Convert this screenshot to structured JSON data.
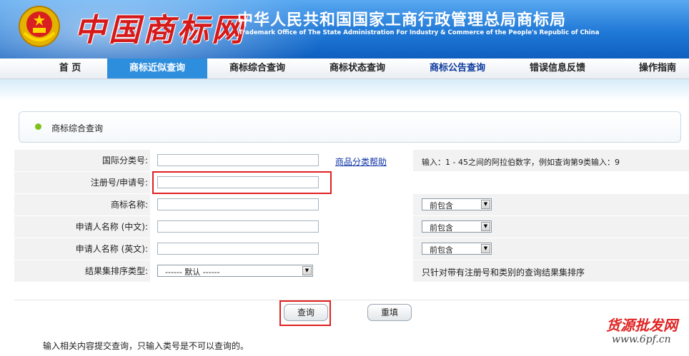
{
  "header": {
    "logo_text": "中国商标网",
    "title_cn": "中华人民共和国国家工商行政管理总局商标局",
    "title_en": "Trademark Office of The State Administration For Industry & Commerce of the People's Republic of China"
  },
  "nav": [
    {
      "label": "首 页",
      "state": "normal"
    },
    {
      "label": "商标近似查询",
      "state": "active"
    },
    {
      "label": "商标综合查询",
      "state": "normal"
    },
    {
      "label": "商标状态查询",
      "state": "normal"
    },
    {
      "label": "商标公告查询",
      "state": "blue"
    },
    {
      "label": "错误信息反馈",
      "state": "normal"
    },
    {
      "label": "操作指南",
      "state": "normal"
    }
  ],
  "section_title": "商标综合查询",
  "form": {
    "class_no": {
      "label": "国际分类号:",
      "value": "",
      "help_link": "商品分类帮助",
      "hint": "输入：1 - 45之间的阿拉伯数字，例如查询第9类输入：9"
    },
    "reg_no": {
      "label": "注册号/申请号:",
      "value": ""
    },
    "tm_name": {
      "label": "商标名称:",
      "value": "",
      "match": "前包含"
    },
    "applicant_cn": {
      "label": "申请人名称 (中文):",
      "value": "",
      "match": "前包含"
    },
    "applicant_en": {
      "label": "申请人名称 (英文):",
      "value": "",
      "match": "前包含"
    },
    "sort": {
      "label": "结果集排序类型:",
      "selected": "------ 默认 ------",
      "hint": "只针对带有注册号和类别的查询结果集排序"
    }
  },
  "buttons": {
    "search": "查询",
    "reset": "重填"
  },
  "note": "输入相关内容提交查询，只输入类号是不可以查询的。",
  "watermark": {
    "cn": "货源批发网",
    "url": "www.6pf.cn"
  },
  "colors": {
    "header_blue": "#1f78d6",
    "nav_active": "#2e8ede",
    "highlight_red": "#e02020",
    "bullet_green": "#7ec21c"
  }
}
